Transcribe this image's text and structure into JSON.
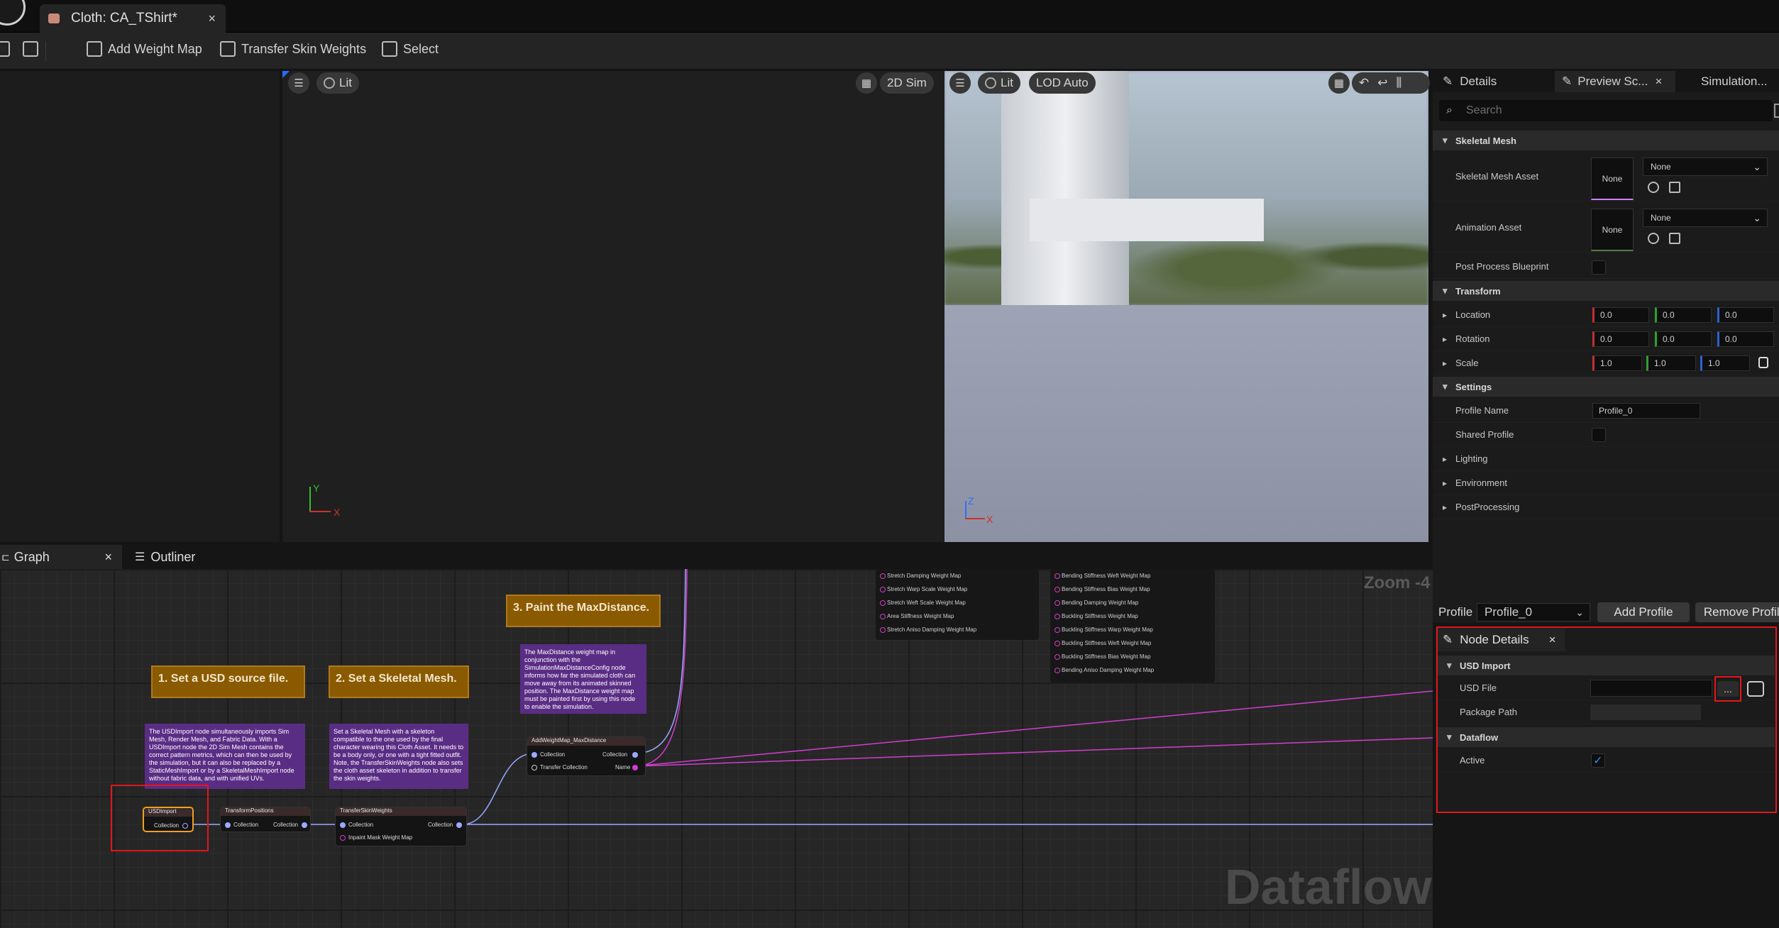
{
  "app": {
    "tab_title": "Cloth: CA_TShirt*",
    "tab_close": "×"
  },
  "toolbar": {
    "add_weight_map": "Add Weight Map",
    "transfer_skin_weights": "Transfer Skin Weights",
    "select": "Select"
  },
  "viewport_left": {
    "lit": "Lit",
    "mode": "2D Sim",
    "axis_y": "Y",
    "axis_x": "X"
  },
  "viewport_right": {
    "lit": "Lit",
    "lod": "LOD Auto",
    "axis_z": "Z",
    "axis_x": "X"
  },
  "details": {
    "tabs": [
      {
        "label": "Details"
      },
      {
        "label": "Preview Sc..."
      },
      {
        "label": "Simulation..."
      }
    ],
    "tab_close": "×",
    "search_placeholder": "Search",
    "sections": {
      "skeletal_mesh": "Skeletal Mesh",
      "transform": "Transform",
      "settings": "Settings"
    },
    "skeletal_mesh_asset": {
      "label": "Skeletal Mesh Asset",
      "thumb": "None",
      "value": "None"
    },
    "animation_asset": {
      "label": "Animation Asset",
      "thumb": "None",
      "value": "None"
    },
    "post_process_blueprint": {
      "label": "Post Process Blueprint"
    },
    "location": {
      "label": "Location",
      "x": "0.0",
      "y": "0.0",
      "z": "0.0"
    },
    "rotation": {
      "label": "Rotation",
      "x": "0.0",
      "y": "0.0",
      "z": "0.0"
    },
    "scale": {
      "label": "Scale",
      "x": "1.0",
      "y": "1.0",
      "z": "1.0"
    },
    "profile_name": {
      "label": "Profile Name",
      "value": "Profile_0"
    },
    "shared_profile": {
      "label": "Shared Profile"
    },
    "lighting": "Lighting",
    "environment": "Environment",
    "postprocessing": "PostProcessing"
  },
  "profile_bar": {
    "label": "Profile",
    "value": "Profile_0",
    "add": "Add Profile",
    "remove": "Remove Profile"
  },
  "node_details": {
    "title": "Node Details",
    "close": "×",
    "usd_import": "USD Import",
    "usd_file": "USD File",
    "browse": "...",
    "package_path": "Package Path",
    "dataflow": "Dataflow",
    "active": "Active",
    "active_checked": true
  },
  "graph_tabs": {
    "graph": "Graph",
    "graph_close": "×",
    "outliner": "Outliner"
  },
  "graph": {
    "zoom": "Zoom -4",
    "watermark": "Dataflow",
    "step1_title": "1. Set a USD source file.",
    "step1_body": "The USDImport node simultaneously imports Sim Mesh, Render Mesh, and Fabric Data. With a USDImport node the 2D Sim Mesh contains the correct pattern metrics, which can then be used by the simulation, but it can also be replaced by a StaticMeshImport or by a SkeletalMeshImport node without fabric data, and with unified UVs.",
    "step2_title": "2. Set a Skeletal Mesh.",
    "step2_body": "Set a Skeletal Mesh with a skeleton compatible to the one used by the final character wearing this Cloth Asset. It needs to be a body only, or one with a tight fitted outfit. Note, the TransferSkinWeights node also sets the cloth asset skeleton in addition to transfer the skin weights.",
    "step3_title": "3. Paint the MaxDistance.",
    "step3_body": "The MaxDistance weight map in conjunction with the SimulationMaxDistanceConfig node informs how far the simulated cloth can move away from its animated skinned position. The MaxDistance weight map must be painted first by using this node to enable the simulation.",
    "node_usdimport": "USDImport",
    "node_transformpositions": "TransformPositions",
    "node_transferskinweights": "TransferSkinWeights",
    "node_addweightmap": "AddWeightMap_MaxDistance",
    "pin_collection": "Collection",
    "pin_transfer_collection": "Transfer Collection",
    "pin_name": "Name",
    "pin_inpaint_mask": "Inpaint Mask Weight Map",
    "list1": [
      "Stretch Damping Weight Map",
      "Stretch Warp Scale Weight Map",
      "Stretch Weft Scale Weight Map",
      "Area Stiffness Weight Map",
      "Stretch Aniso Damping Weight Map"
    ],
    "list2": [
      "Bending Stiffness Weft Weight Map",
      "Bending Stiffness Bias Weight Map",
      "Bending Damping Weight Map",
      "Buckling Stiffness Weight Map",
      "Buckling Stiffness Warp Weight Map",
      "Buckling Stiffness Weft Weight Map",
      "Buckling Stiffness Bias Weight Map",
      "Bending Aniso Damping Weight Map"
    ]
  },
  "colors": {
    "accent_highlight": "#e3161d",
    "comment_title": "#8a5a00",
    "comment_body": "#5a2d85",
    "wire_pink": "#d23ed0",
    "wire_blue": "#9aa9ff",
    "selected_node": "#f0a020"
  }
}
